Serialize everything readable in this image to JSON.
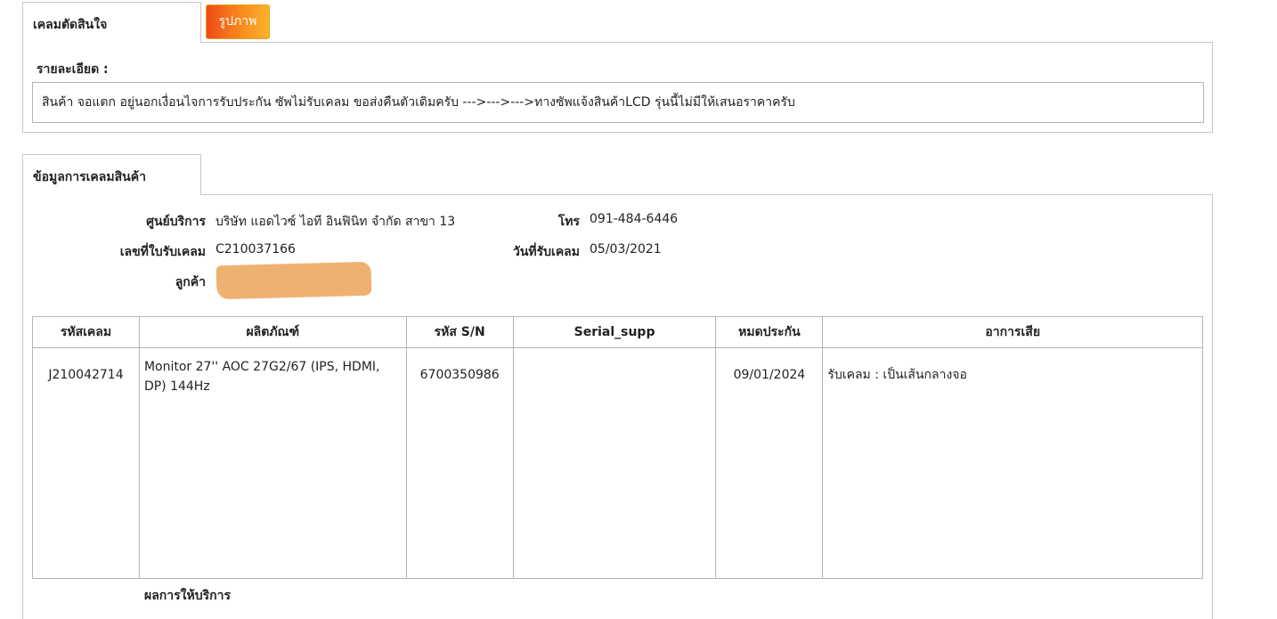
{
  "claim_decision": {
    "tab_label": "เคลมตัดสินใจ",
    "image_button_label": "รูปภาพ",
    "detail_label": "รายละเอียด :",
    "detail_text": "สินค้า จอแตก อยู่นอกเงื่อนไจการรับประกัน ซัพไม่รับเคลม ขอส่งคืนตัวเดิมครับ --->--->--->ทางซัพแจ้งสินค้าLCD รุ่นนี้ไม่มีให้เสนอราคาครับ"
  },
  "claim_info": {
    "tab_label": "ข้อมูลการเคลมสินค้า",
    "service_center_label": "ศูนย์บริการ",
    "service_center_value": "บริษัท แอดไวซ์ ไอที อินฟินิท จำกัด สาขา 13",
    "phone_label": "โทร",
    "phone_value": "091-484-6446",
    "receipt_no_label": "เลขที่ใบรับเคลม",
    "receipt_no_value": "C210037166",
    "receipt_date_label": "วันที่รับเคลม",
    "receipt_date_value": "05/03/2021",
    "customer_label": "ลูกค้า",
    "result_label": "ผลการให้บริการ"
  },
  "table": {
    "headers": [
      "รหัสเคลม",
      "ผลิตภัณฑ์",
      "รหัส S/N",
      "Serial_supp",
      "หมดประกัน",
      "อาการเสีย"
    ],
    "rows": [
      {
        "claim_code": "J210042714",
        "product": "Monitor 27'' AOC 27G2/67 (IPS, HDMI, DP) 144Hz",
        "sn": "6700350986",
        "serial_supp": "",
        "warranty_end": "09/01/2024",
        "symptom": "รับเคลม : เป็นเส้นกลางจอ"
      }
    ]
  },
  "colors": {
    "button_gradient_start": "#f24a18",
    "button_gradient_end": "#fbb32b",
    "redaction": "#eead6a",
    "border": "#c8c8c8"
  }
}
